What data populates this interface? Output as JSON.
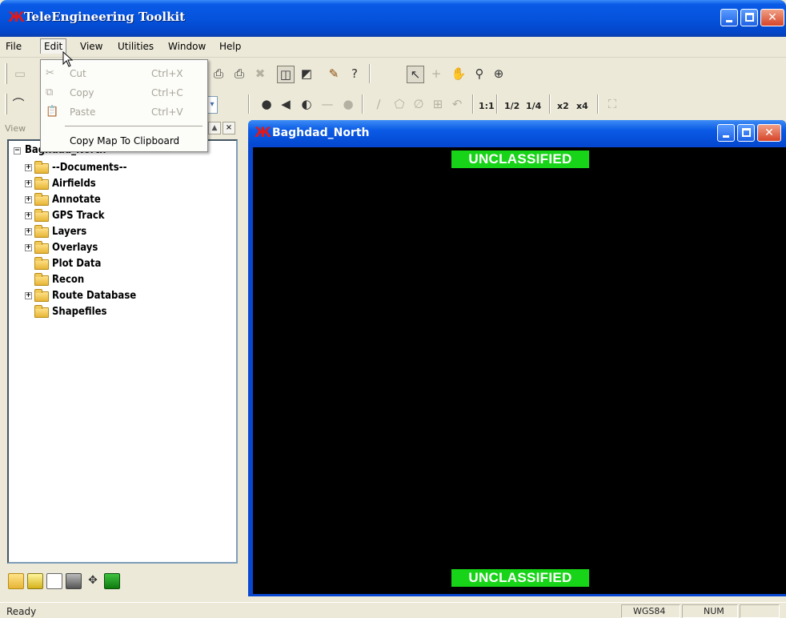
{
  "app": {
    "title": "TeleEngineering Toolkit",
    "logo_glyph": "Ж"
  },
  "menu": [
    "File",
    "Edit",
    "View",
    "Utilities",
    "Window",
    "Help"
  ],
  "edit_menu": {
    "items": [
      {
        "label": "Cut",
        "shortcut": "Ctrl+X",
        "icon": "scissors-icon",
        "enabled": false
      },
      {
        "label": "Copy",
        "shortcut": "Ctrl+C",
        "icon": "copy-icon",
        "enabled": false
      },
      {
        "label": "Paste",
        "shortcut": "Ctrl+V",
        "icon": "paste-icon",
        "enabled": false
      },
      {
        "label": "Copy Map To Clipboard",
        "shortcut": "",
        "icon": "",
        "enabled": true
      }
    ]
  },
  "toolbar2": {
    "scale_labels": [
      "1:1",
      "1/2",
      "1/4",
      "x2",
      "x4"
    ]
  },
  "left_panel": {
    "header": "View",
    "root": "Baghdad_North",
    "items": [
      {
        "label": "--Documents--",
        "expandable": true
      },
      {
        "label": "Airfields",
        "expandable": true
      },
      {
        "label": "Annotate",
        "expandable": true
      },
      {
        "label": "GPS Track",
        "expandable": true
      },
      {
        "label": "Layers",
        "expandable": true
      },
      {
        "label": "Overlays",
        "expandable": true
      },
      {
        "label": "Plot Data",
        "expandable": false
      },
      {
        "label": "Recon",
        "expandable": false
      },
      {
        "label": "Route Database",
        "expandable": true
      },
      {
        "label": "Shapefiles",
        "expandable": false
      }
    ]
  },
  "map_window": {
    "title": "Baghdad_North",
    "classification_top": "UNCLASSIFIED",
    "classification_bottom": "UNCLASSIFIED"
  },
  "status": {
    "text": "Ready",
    "datum": "WGS84",
    "num": "NUM"
  },
  "colors": {
    "titlebar": "#0553dd",
    "classification_bg": "#18d418",
    "map_bg": "#000000"
  }
}
